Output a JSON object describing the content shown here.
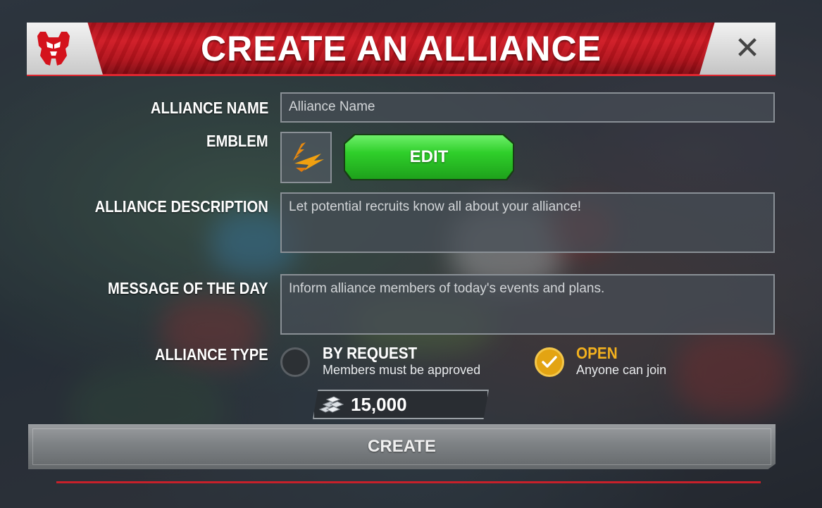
{
  "header": {
    "title": "CREATE AN ALLIANCE",
    "logo_icon": "autobot-logo-icon",
    "close_label": "✕"
  },
  "form": {
    "alliance_name": {
      "label": "ALLIANCE NAME",
      "placeholder": "Alliance Name",
      "value": ""
    },
    "emblem": {
      "label": "EMBLEM",
      "edit_label": "EDIT",
      "icon": "lightning-emblem-icon"
    },
    "description": {
      "label": "ALLIANCE DESCRIPTION",
      "placeholder": "Let potential recruits know all about your alliance!",
      "value": ""
    },
    "motd": {
      "label": "MESSAGE OF THE DAY",
      "placeholder": "Inform alliance members of today's events and plans.",
      "value": ""
    },
    "alliance_type": {
      "label": "ALLIANCE TYPE",
      "options": [
        {
          "title": "BY REQUEST",
          "subtitle": "Members must be approved",
          "selected": false
        },
        {
          "title": "OPEN",
          "subtitle": "Anyone can join",
          "selected": true
        }
      ]
    }
  },
  "cost": {
    "value": "15,000",
    "icon": "silver-ingots-icon"
  },
  "footer": {
    "create_label": "CREATE"
  },
  "colors": {
    "header_red": "#c8141e",
    "edit_green": "#2fcf2a",
    "selected_gold": "#e3a412",
    "open_title": "#f2b01e"
  }
}
